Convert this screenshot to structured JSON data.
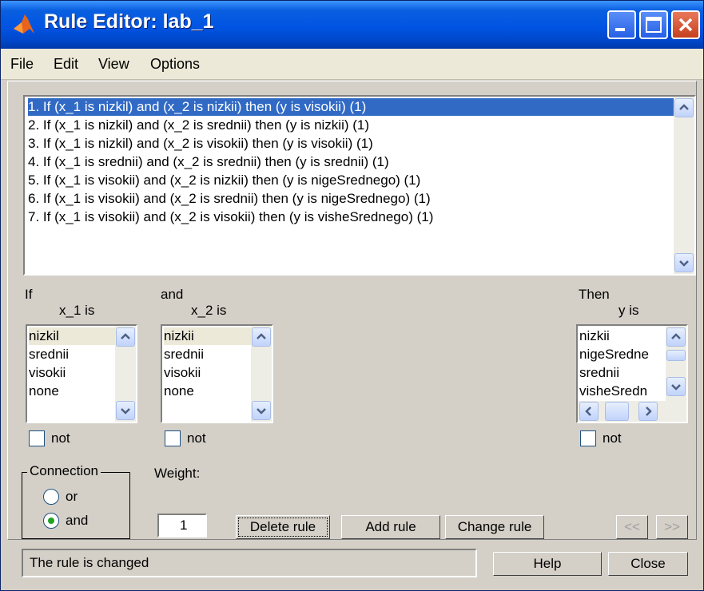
{
  "window": {
    "title": "Rule Editor: lab_1"
  },
  "menu": [
    "File",
    "Edit",
    "View",
    "Options"
  ],
  "rules": [
    "1. If (x_1 is nizkil) and (x_2 is nizkii) then (y is visokii) (1)",
    "2. If (x_1 is nizkil) and (x_2 is srednii) then (y is nizkii) (1)",
    "3. If (x_1 is nizkil) and (x_2 is visokii) then (y is visokii) (1)",
    "4. If (x_1 is srednii) and (x_2 is srednii) then (y is srednii) (1)",
    "5. If (x_1 is visokii) and (x_2 is nizkii) then (y is nigeSrednego) (1)",
    "6. If (x_1 is visokii) and (x_2 is srednii) then (y is nigeSrednego) (1)",
    "7. If (x_1 is visokii) and (x_2 is visokii) then (y is visheSrednego) (1)"
  ],
  "selected_rule_index": 0,
  "antecedent1": {
    "caption": "If",
    "var_label": "x_1 is",
    "items": [
      "nizkil",
      "srednii",
      "visokii",
      "none"
    ],
    "not_label": "not"
  },
  "antecedent2": {
    "caption": "and",
    "var_label": "x_2 is",
    "items": [
      "nizkii",
      "srednii",
      "visokii",
      "none"
    ],
    "not_label": "not"
  },
  "consequent": {
    "caption": "Then",
    "var_label": "y is",
    "items": [
      "nizkii",
      "nigeSredne",
      "srednii",
      "visheSredn"
    ],
    "not_label": "not"
  },
  "connection": {
    "label": "Connection",
    "options": [
      "or",
      "and"
    ],
    "selected": "and"
  },
  "weight": {
    "label": "Weight:",
    "value": "1"
  },
  "buttons": {
    "delete": "Delete rule",
    "add": "Add rule",
    "change": "Change rule",
    "prev": "<<",
    "next": ">>",
    "help": "Help",
    "close": "Close"
  },
  "status_text": "The rule is changed",
  "colors": {
    "titlebar": "#0054e3",
    "selection": "#316ac5",
    "face": "#d4d0c8"
  },
  "icons": [
    "matlab-logo-icon",
    "minimize-icon",
    "maximize-icon",
    "close-icon",
    "arrow-up-icon",
    "arrow-down-icon",
    "arrow-left-icon",
    "arrow-right-icon"
  ]
}
